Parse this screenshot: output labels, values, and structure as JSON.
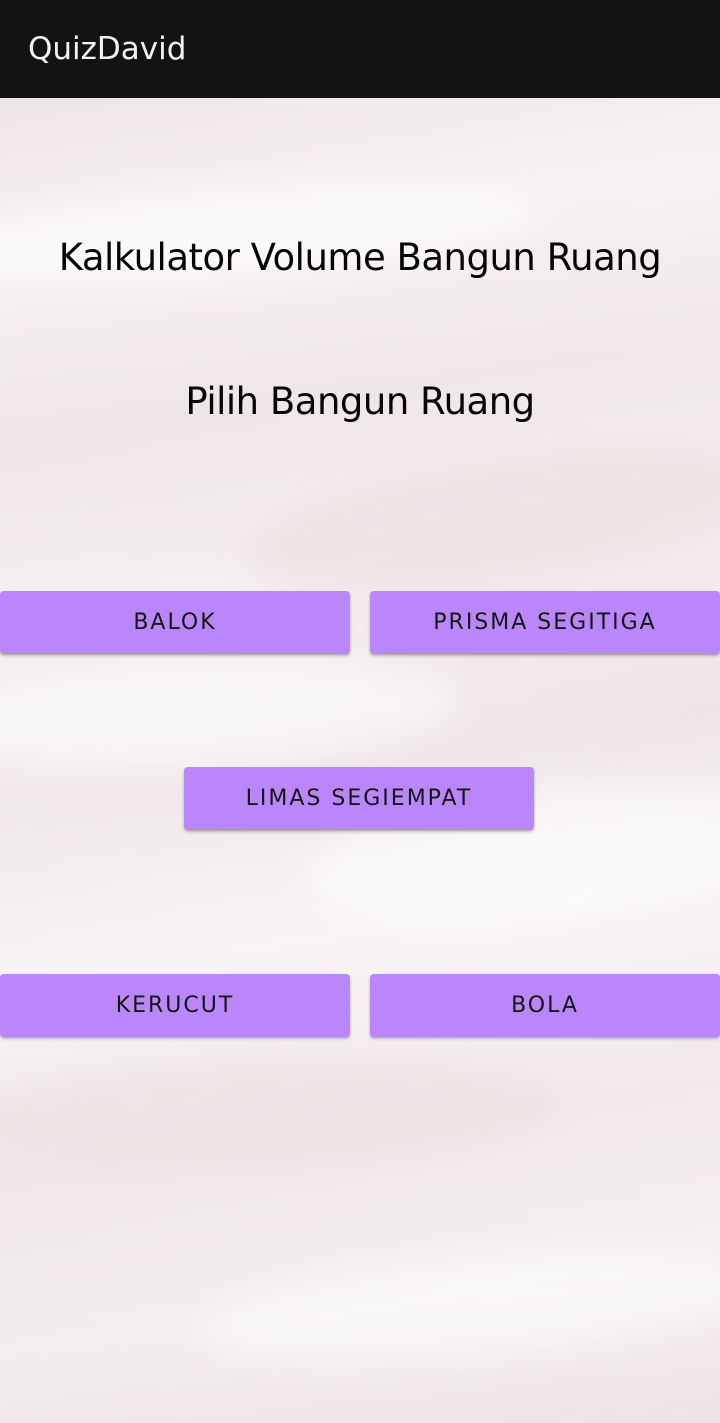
{
  "app_bar": {
    "title": "QuizDavid"
  },
  "main": {
    "title": "Kalkulator Volume Bangun Ruang",
    "subtitle": "Pilih Bangun Ruang",
    "buttons": {
      "balok": "BALOK",
      "prisma_segitiga": "PRISMA SEGITIGA",
      "limas_segiempat": "LIMAS SEGIEMPAT",
      "kerucut": "KERUCUT",
      "bola": "BOLA"
    }
  },
  "colors": {
    "app_bar": "#131313",
    "button": "#bb86fc",
    "background": "#f6f0f0"
  }
}
